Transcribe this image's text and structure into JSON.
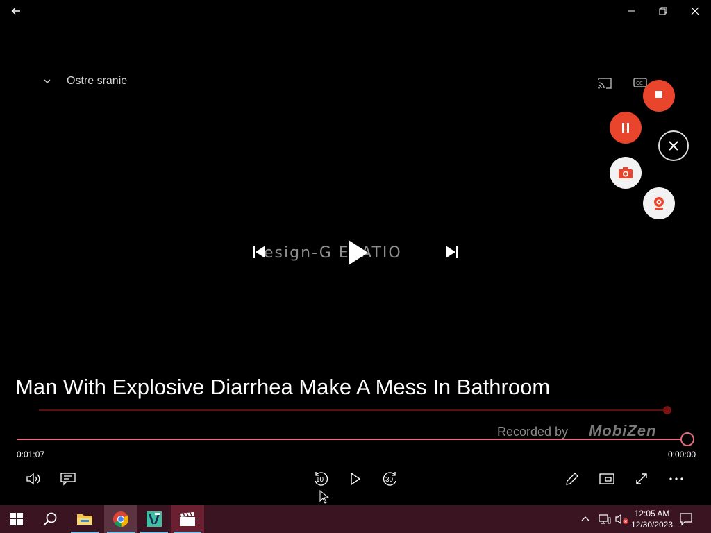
{
  "window": {
    "back_label": "Back",
    "minimize_label": "Minimize",
    "maximize_label": "Restore",
    "close_label": "Close"
  },
  "video": {
    "overlay_title": "Ostre sranie",
    "watermark": "esign-G ERATIO",
    "caption": "Man With Explosive Diarrhea Make A Mess In  Bathroom",
    "recorded_by": "Recorded by",
    "recorder_brand": "MobiZen",
    "stop_label": "STOP"
  },
  "player": {
    "elapsed": "0:01:07",
    "remaining": "0:00:00",
    "progress": 1.0,
    "rewind_seconds": "10",
    "forward_seconds": "30"
  },
  "taskbar": {
    "time": "12:05 AM",
    "date": "12/30/2023"
  },
  "colors": {
    "seek_accent": "#e66a80",
    "record_red": "#e8452c",
    "taskbar_bg": "#3a1421"
  }
}
